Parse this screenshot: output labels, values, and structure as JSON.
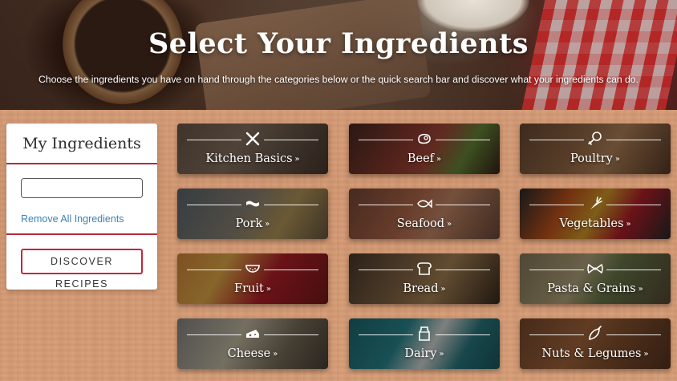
{
  "hero": {
    "title": "Select Your Ingredients",
    "subtitle": "Choose the ingredients you have on hand through the categories below or the quick search bar and discover what your ingredients can do."
  },
  "sidebar": {
    "title": "My Ingredients",
    "search_value": "",
    "search_placeholder": "",
    "remove_all_label": "Remove All Ingredients",
    "discover_label": "DISCOVER RECIPES"
  },
  "categories": [
    {
      "label": "Kitchen Basics",
      "icon": "utensils-icon"
    },
    {
      "label": "Beef",
      "icon": "steak-icon"
    },
    {
      "label": "Poultry",
      "icon": "drumstick-icon"
    },
    {
      "label": "Pork",
      "icon": "bacon-icon"
    },
    {
      "label": "Seafood",
      "icon": "fish-icon"
    },
    {
      "label": "Vegetables",
      "icon": "carrot-icon"
    },
    {
      "label": "Fruit",
      "icon": "watermelon-icon"
    },
    {
      "label": "Bread",
      "icon": "bread-icon"
    },
    {
      "label": "Pasta & Grains",
      "icon": "bowtie-pasta-icon"
    },
    {
      "label": "Cheese",
      "icon": "cheese-icon"
    },
    {
      "label": "Dairy",
      "icon": "milk-carton-icon"
    },
    {
      "label": "Nuts & Legumes",
      "icon": "nut-icon"
    }
  ],
  "chevron": "»",
  "colors": {
    "accent_red": "#c2283a",
    "link_blue": "#3a82b8"
  }
}
